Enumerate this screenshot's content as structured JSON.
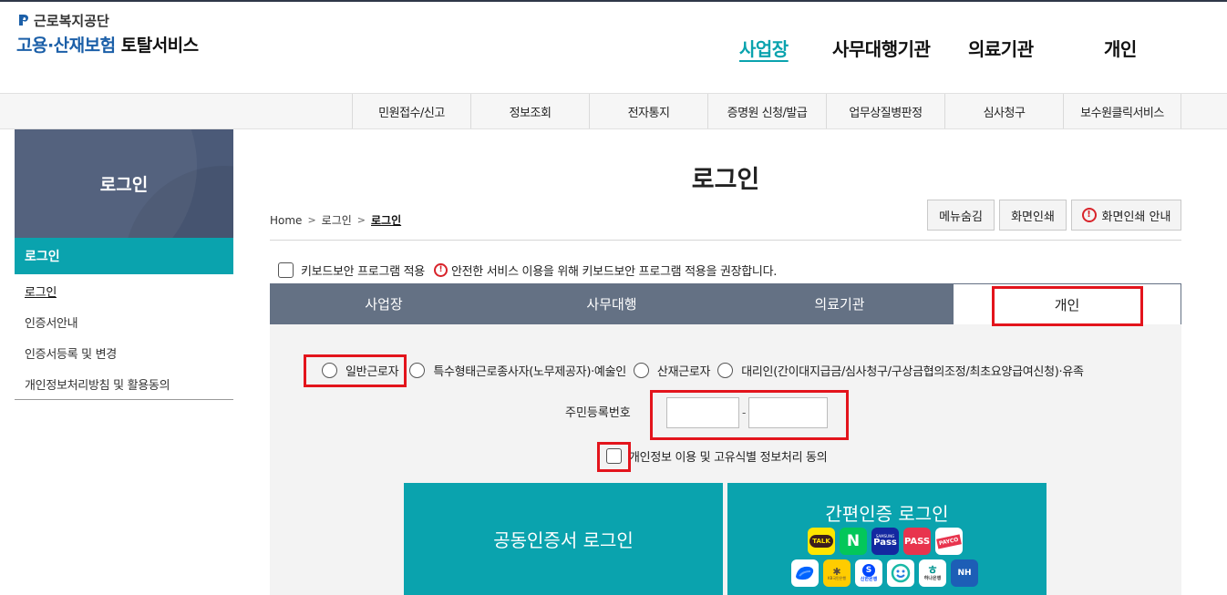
{
  "header": {
    "logo_top": "근로복지공단",
    "logo_title_blue": "고용·산재보험",
    "logo_title_dark": "토탈서비스"
  },
  "gnb": [
    "사업장",
    "사무대행기관",
    "의료기관",
    "개인"
  ],
  "subnav": [
    "민원접수/신고",
    "정보조회",
    "전자통지",
    "증명원 신청/발급",
    "업무상질병판정",
    "심사청구",
    "보수원클릭서비스"
  ],
  "lnb": {
    "title": "로그인",
    "active": "로그인",
    "links": [
      "로그인",
      "인증서안내",
      "인증서등록 및 변경",
      "개인정보처리방침 및 활용동의"
    ]
  },
  "page": {
    "title": "로그인",
    "breadcrumb": [
      "Home",
      "로그인",
      "로그인"
    ],
    "btn_hide_menu": "메뉴숨김",
    "btn_print": "화면인쇄",
    "btn_print_guide": "화면인쇄 안내"
  },
  "keyboard": {
    "label": "키보드보안 프로그램 적용",
    "notice": "안전한 서비스 이용을 위해 키보드보안 프로그램 적용을 권장합니다."
  },
  "tabs": [
    "사업장",
    "사무대행",
    "의료기관",
    "개인"
  ],
  "form": {
    "radios": [
      "일반근로자",
      "특수형태근로종사자(노무제공자)·예술인",
      "산재근로자",
      "대리인(간이대지급금/심사청구/구상금협의조정/최초요양급여신청)·유족"
    ],
    "rrn_label": "주민등록번호",
    "rrn_dash": "-",
    "rrn_front": "",
    "rrn_back": "",
    "agree_label": "개인정보 이용 및 고유식별 정보처리 동의"
  },
  "buttons": {
    "cert_login": "공동인증서 로그인",
    "simple_login": "간편인증 로그인"
  },
  "auth_icons": {
    "kakao": "TALK",
    "naver": "N",
    "pass_samsung": "Pass",
    "pass_samsung_sub": "SAMSUNG",
    "pass": "PASS",
    "payco": "PAYCO",
    "kb_sub": "KB국민은행",
    "shinhan_sub": "신한은행",
    "hana_sub": "하나은행",
    "nh": "NH"
  },
  "colors": {
    "accent": "#0aa3ae",
    "tab_bg": "#647184",
    "lnb_head": "#4b5a78",
    "highlight": "#e3141c"
  }
}
